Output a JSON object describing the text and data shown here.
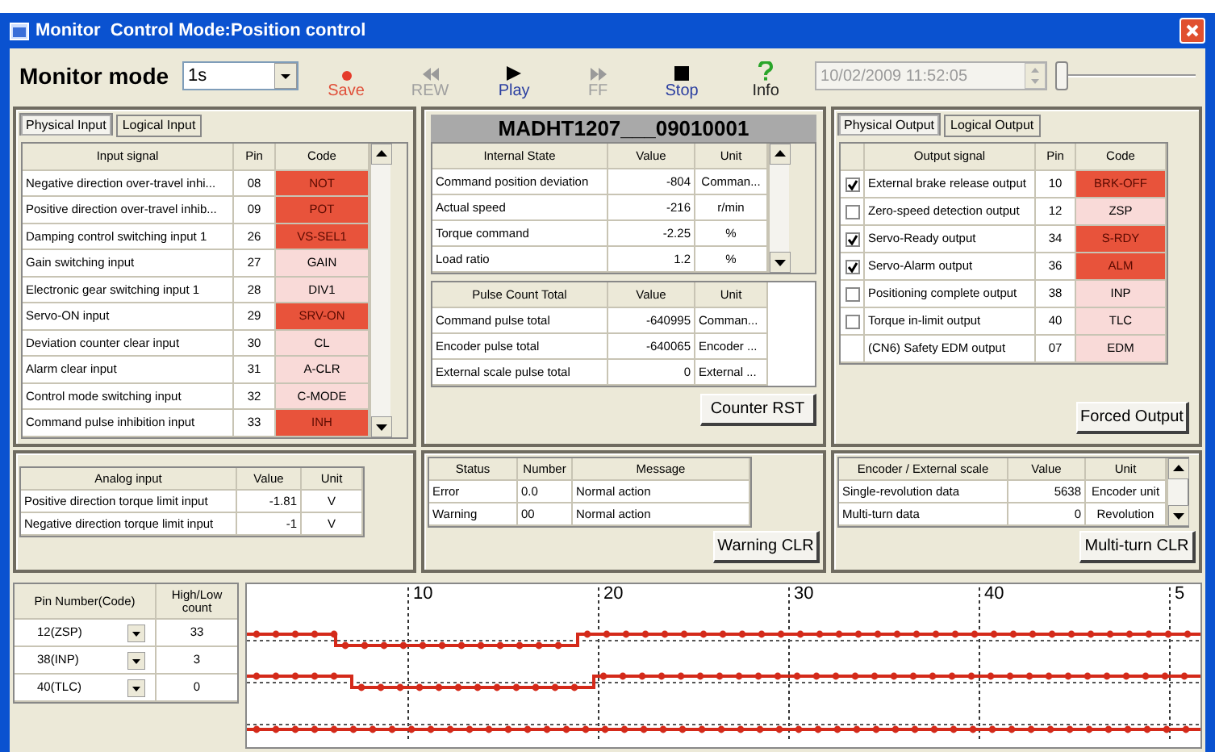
{
  "window": {
    "title": "Monitor  Control Mode:Position control"
  },
  "toolbar": {
    "label": "Monitor mode",
    "mode": "1s",
    "buttons": [
      {
        "kind": "save",
        "label": "Save",
        "disabled": false
      },
      {
        "kind": "rew",
        "label": "REW",
        "disabled": true
      },
      {
        "kind": "play",
        "label": "Play",
        "disabled": false
      },
      {
        "kind": "ff",
        "label": "FF",
        "disabled": true
      },
      {
        "kind": "stop",
        "label": "Stop",
        "disabled": false
      },
      {
        "kind": "info",
        "label": "Info",
        "disabled": false
      }
    ],
    "timestamp": "10/02/2009 11:52:05",
    "slider": {
      "level": 0.02
    }
  },
  "input_panel": {
    "tabs": [
      {
        "label": "Physical Input",
        "selected": true
      },
      {
        "label": "Logical Input",
        "selected": false
      }
    ],
    "columns": [
      "Input signal",
      "Pin",
      "Code"
    ],
    "rows": [
      {
        "signal": "Negative direction over-travel inhi...",
        "pin": "08",
        "code": "NOT",
        "active": true
      },
      {
        "signal": "Positive direction over-travel inhib...",
        "pin": "09",
        "code": "POT",
        "active": true
      },
      {
        "signal": "Damping control switching input 1",
        "pin": "26",
        "code": "VS-SEL1",
        "active": true
      },
      {
        "signal": "Gain switching input",
        "pin": "27",
        "code": "GAIN",
        "active": false
      },
      {
        "signal": "Electronic gear switching input 1",
        "pin": "28",
        "code": "DIV1",
        "active": false
      },
      {
        "signal": "Servo-ON input",
        "pin": "29",
        "code": "SRV-ON",
        "active": true
      },
      {
        "signal": "Deviation counter clear input",
        "pin": "30",
        "code": "CL",
        "active": false
      },
      {
        "signal": "Alarm clear input",
        "pin": "31",
        "code": "A-CLR",
        "active": false
      },
      {
        "signal": "Control mode switching input",
        "pin": "32",
        "code": "C-MODE",
        "active": false
      },
      {
        "signal": "Command pulse inhibition input",
        "pin": "33",
        "code": "INH",
        "active": true
      }
    ]
  },
  "state_panel": {
    "model": "MADHT1207___09010001",
    "internal_state": {
      "columns": [
        "Internal State",
        "Value",
        "Unit"
      ],
      "rows": [
        [
          "Command position deviation",
          "-804",
          "Comman..."
        ],
        [
          "Actual speed",
          "-216",
          "r/min"
        ],
        [
          "Torque command",
          "-2.25",
          "%"
        ],
        [
          "Load ratio",
          "1.2",
          "%"
        ]
      ]
    },
    "pulse_count": {
      "columns": [
        "Pulse Count Total",
        "Value",
        "Unit"
      ],
      "rows": [
        [
          "Command pulse total",
          "-640995",
          "Comman..."
        ],
        [
          "Encoder pulse total",
          "-640065",
          "Encoder ..."
        ],
        [
          "External scale pulse total",
          "0",
          "External ..."
        ]
      ]
    },
    "button": "Counter RST"
  },
  "output_panel": {
    "tabs": [
      {
        "label": "Physical Output",
        "selected": true
      },
      {
        "label": "Logical Output",
        "selected": false
      }
    ],
    "columns": [
      "Output signal",
      "Pin",
      "Code"
    ],
    "rows": [
      {
        "kind": "checkbox",
        "checked": true,
        "signal": "External brake release output",
        "pin": "10",
        "code": "BRK-OFF",
        "active": true
      },
      {
        "kind": "checkbox",
        "checked": false,
        "signal": "Zero-speed detection output",
        "pin": "12",
        "code": "ZSP",
        "active": false
      },
      {
        "kind": "checkbox",
        "checked": true,
        "signal": "Servo-Ready output",
        "pin": "34",
        "code": "S-RDY",
        "active": true
      },
      {
        "kind": "checkbox",
        "checked": true,
        "signal": "Servo-Alarm output",
        "pin": "36",
        "code": "ALM",
        "active": true
      },
      {
        "kind": "checkbox",
        "checked": false,
        "signal": "Positioning complete output",
        "pin": "38",
        "code": "INP",
        "active": false
      },
      {
        "kind": "checkbox",
        "checked": false,
        "signal": "Torque in-limit output",
        "pin": "40",
        "code": "TLC",
        "active": false
      },
      {
        "kind": "plain",
        "signal": "(CN6) Safety EDM output",
        "pin": "07",
        "code": "EDM",
        "active": false
      }
    ],
    "button": "Forced Output"
  },
  "analog_panel": {
    "columns": [
      "Analog input",
      "Value",
      "Unit"
    ],
    "rows": [
      [
        "Positive direction torque limit input",
        "-1.81",
        "V"
      ],
      [
        "Negative direction torque limit input",
        "-1",
        "V"
      ]
    ]
  },
  "status_panel": {
    "columns": [
      "Status",
      "Number",
      "Message"
    ],
    "rows": [
      [
        "Error",
        "0.0",
        "Normal action"
      ],
      [
        "Warning",
        "00",
        "Normal action"
      ]
    ],
    "button": "Warning CLR"
  },
  "encoder_panel": {
    "columns": [
      "Encoder / External scale",
      "Value",
      "Unit"
    ],
    "rows": [
      [
        "Single-revolution data",
        "5638",
        "Encoder unit"
      ],
      [
        "Multi-turn data",
        "0",
        "Revolution"
      ]
    ],
    "button": "Multi-turn CLR"
  },
  "pin_monitor": {
    "columns": [
      "Pin Number(Code)",
      "High/Low count"
    ],
    "rows": [
      {
        "pin": "12(ZSP)",
        "count": "33"
      },
      {
        "pin": "38(INP)",
        "count": "3"
      },
      {
        "pin": "40(TLC)",
        "count": "0"
      }
    ],
    "ticks": [
      "10",
      "20",
      "30",
      "40",
      "5"
    ]
  }
}
